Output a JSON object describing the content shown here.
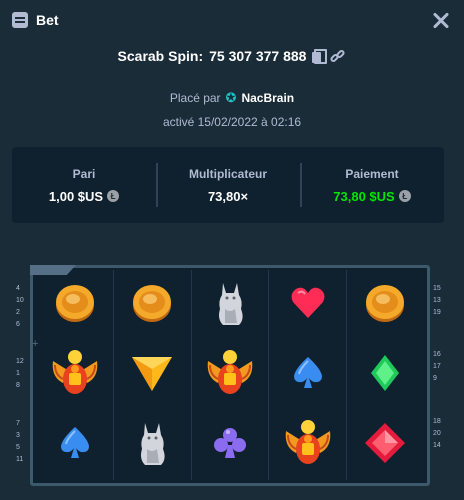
{
  "header": {
    "title": "Bet"
  },
  "game": {
    "name": "Scarab Spin:",
    "bet_id": "75 307 377 888"
  },
  "placed": {
    "prefix": "Placé par",
    "username": "NacBrain",
    "date": "activé 15/02/2022 à 02:16"
  },
  "stats": {
    "bet": {
      "label": "Pari",
      "value": "1,00 $US"
    },
    "multiplier": {
      "label": "Multiplicateur",
      "value": "73,80×"
    },
    "payout": {
      "label": "Paiement",
      "value": "73,80 $US"
    }
  },
  "currency_icon": "litecoin-icon",
  "colors": {
    "accent_green": "#00e701",
    "background": "#1a2c38",
    "panel": "#0f212e",
    "muted": "#b1bad3"
  },
  "reels": [
    [
      "coin",
      "coin",
      "cat",
      "heart",
      "coin"
    ],
    [
      "scarab",
      "triangle",
      "scarab",
      "spade",
      "diamond-green"
    ],
    [
      "spade",
      "cat",
      "club",
      "scarab",
      "diamond-red"
    ]
  ],
  "paylines": {
    "left": [
      [
        "4",
        "10",
        "2",
        "6"
      ],
      [
        "12",
        "1",
        "8"
      ],
      [
        "7",
        "3",
        "5",
        "11"
      ]
    ],
    "right": [
      [
        "15",
        "13",
        "19"
      ],
      [
        "16",
        "17",
        "9"
      ],
      [
        "18",
        "20",
        "14"
      ]
    ]
  }
}
